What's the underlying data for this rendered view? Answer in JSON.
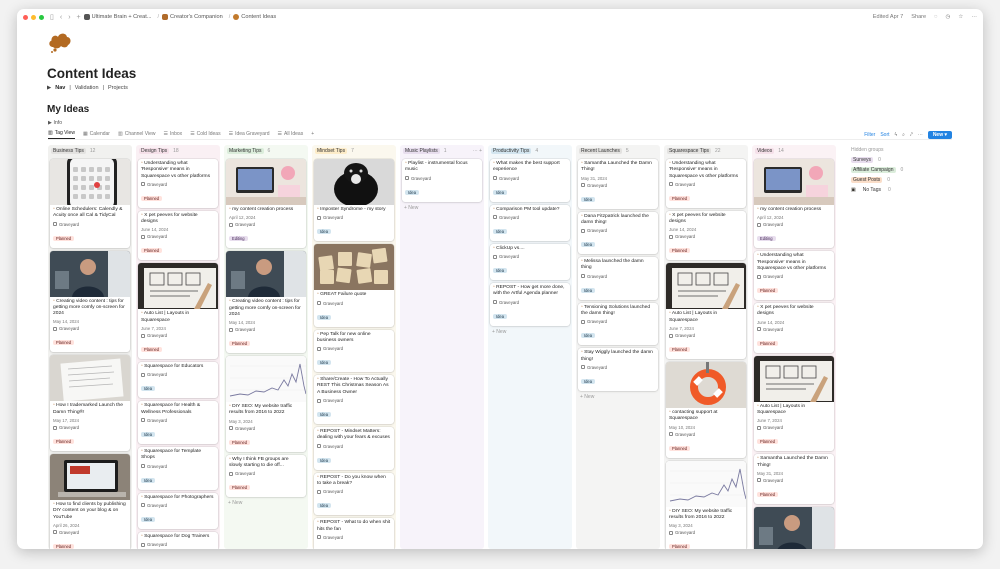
{
  "topbar": {
    "breadcrumbs": [
      "Ultimate Brain + Creat...",
      "Creator's Companion",
      "Content Ideas"
    ],
    "edited": "Edited Apr 7",
    "share": "Share"
  },
  "page": {
    "title": "Content Ideas",
    "nav_label": "Nav",
    "nav_links": [
      "Validation",
      "Projects"
    ],
    "section_title": "My Ideas",
    "info_label": "Info"
  },
  "views": [
    "Tag View",
    "Calendar",
    "Channel View",
    "Inbox",
    "Cold Ideas",
    "Idea Graveyard",
    "All Ideas"
  ],
  "tools": {
    "filter": "Filter",
    "sort": "Sort",
    "new": "New"
  },
  "columns": [
    {
      "name": "Business Tips",
      "count": "12",
      "color": "#f1f1ef",
      "chip": "#e3e2e0",
      "new": "",
      "cards": [
        {
          "cover": "phone",
          "title": "Online Schedulers: Calendly & Acuity once all Cal & TidyCal",
          "date": "",
          "group": "Graveyard",
          "tag": "Planned",
          "tagc": "planned"
        },
        {
          "cover": "man",
          "title": "Creating video content : tips for getting more comfy on-screen for 2024",
          "date": "May 14, 2024",
          "group": "Graveyard",
          "tag": "Planned",
          "tagc": "planned"
        },
        {
          "cover": "paper",
          "title": "How I trademarked Launch the Damn Thing®!",
          "date": "May 17, 2024",
          "group": "Graveyard",
          "tag": "Planned",
          "tagc": "planned"
        },
        {
          "cover": "laptop",
          "title": "How to find clients by publishing DIY content on your blog & on YouTube",
          "date": "April 26, 2024",
          "group": "Graveyard",
          "tag": "Planned",
          "tagc": "planned"
        }
      ]
    },
    {
      "name": "Design Tips",
      "count": "18",
      "color": "#faf0f4",
      "chip": "#f5e0e9",
      "new": "",
      "cards": [
        {
          "cover": "",
          "title": "Understanding what 'Responsive' means in Squarespace vs other platforms",
          "date": "",
          "group": "Graveyard",
          "tag": "Planned",
          "tagc": "planned"
        },
        {
          "cover": "",
          "title": "X pet peeves for website designs",
          "date": "June 14, 2024",
          "group": "Graveyard",
          "tag": "Planned",
          "tagc": "planned"
        },
        {
          "cover": "sketch",
          "title": "Auto List | Layouts in Squarespace",
          "date": "June 7, 2024",
          "group": "Graveyard",
          "tag": "Planned",
          "tagc": "planned"
        },
        {
          "cover": "",
          "title": "Squarespace for Educators",
          "date": "",
          "group": "Graveyard",
          "tag": "Idea",
          "tagc": "idea"
        },
        {
          "cover": "",
          "title": "Squarespace for Health & Wellness Professionals",
          "date": "",
          "group": "Graveyard",
          "tag": "Idea",
          "tagc": "idea"
        },
        {
          "cover": "",
          "title": "Squarespace for Template Shops",
          "date": "",
          "group": "Graveyard",
          "tag": "Idea",
          "tagc": "idea"
        },
        {
          "cover": "",
          "title": "Squarespace for Photographers",
          "date": "",
          "group": "Graveyard",
          "tag": "Idea",
          "tagc": "idea"
        },
        {
          "cover": "",
          "title": "Squarespace for Dog Trainers",
          "date": "",
          "group": "Graveyard",
          "tag": "Idea",
          "tagc": "idea"
        },
        {
          "cover": "",
          "title": "Squarespace for Lawyers",
          "date": "",
          "group": "Graveyard",
          "tag": "",
          "tagc": ""
        }
      ]
    },
    {
      "name": "Marketing Tips",
      "count": "6",
      "color": "#f4f9f2",
      "chip": "#dbeddb",
      "new": "+ New",
      "cards": [
        {
          "cover": "desk",
          "title": "my content creation process",
          "date": "April 12, 2024",
          "group": "Graveyard",
          "tag": "Editing",
          "tagc": "editing"
        },
        {
          "cover": "man",
          "title": "Creating video content : tips for getting more comfy on-screen for 2024",
          "date": "May 14, 2024",
          "group": "Graveyard",
          "tag": "Planned",
          "tagc": "planned"
        },
        {
          "cover": "graph",
          "title": "DIY SEO: My website traffic results from 2016 to 2022",
          "date": "May 3, 2024",
          "group": "Graveyard",
          "tag": "Planned",
          "tagc": "planned"
        },
        {
          "cover": "",
          "title": "Why I think FB groups are slowly starting to die off...",
          "date": "",
          "group": "Graveyard",
          "tag": "Planned",
          "tagc": "planned"
        }
      ]
    },
    {
      "name": "Mindset Tips",
      "count": "7",
      "color": "#fbf8ee",
      "chip": "#fdecc8",
      "new": "+ New",
      "cards": [
        {
          "cover": "dog",
          "title": "Imposter Syndrome - my story",
          "date": "",
          "group": "Graveyard",
          "tag": "Idea",
          "tagc": "idea"
        },
        {
          "cover": "scrabble",
          "title": "GREAT Failure quote",
          "date": "",
          "group": "Graveyard",
          "tag": "Idea",
          "tagc": "idea"
        },
        {
          "cover": "",
          "title": "Pep Talk for new online business owners",
          "date": "",
          "group": "Graveyard",
          "tag": "Idea",
          "tagc": "idea"
        },
        {
          "cover": "",
          "title": "Share/Create - How To Actually REST This Christmas Season As A Business Owner",
          "date": "",
          "group": "Graveyard",
          "tag": "Idea",
          "tagc": "idea"
        },
        {
          "cover": "",
          "title": "REPOST - Mindset Matters: dealing with your fears & excuses",
          "date": "",
          "group": "Graveyard",
          "tag": "Idea",
          "tagc": "idea"
        },
        {
          "cover": "",
          "title": "REPOST - Do you know when to take a break?",
          "date": "",
          "group": "Graveyard",
          "tag": "Idea",
          "tagc": "idea"
        },
        {
          "cover": "",
          "title": "REPOST - What to do when shit hits the fan",
          "date": "",
          "group": "Graveyard",
          "tag": "Idea",
          "tagc": "idea"
        }
      ]
    },
    {
      "name": "Music Playlists",
      "count": "1",
      "color": "#f7f3fa",
      "chip": "#e8deee",
      "new": "+ New",
      "cards": [
        {
          "cover": "",
          "title": "Playlist - instrumental focus music",
          "date": "",
          "group": "Graveyard",
          "tag": "Idea",
          "tagc": "idea"
        }
      ]
    },
    {
      "name": "Productivity Tips",
      "count": "4",
      "color": "#f2f7fa",
      "chip": "#d3e5ef",
      "new": "+ New",
      "cards": [
        {
          "cover": "",
          "title": "What makes the best support experience",
          "date": "",
          "group": "Graveyard",
          "tag": "Idea",
          "tagc": "idea"
        },
        {
          "cover": "",
          "title": "Comparison PM tool update?",
          "date": "",
          "group": "Graveyard",
          "tag": "Idea",
          "tagc": "idea"
        },
        {
          "cover": "",
          "title": "ClickUp vs....",
          "date": "",
          "group": "Graveyard",
          "tag": "Idea",
          "tagc": "idea"
        },
        {
          "cover": "",
          "title": "REPOST - How get more done, with the Artful Agenda planner",
          "date": "",
          "group": "Graveyard",
          "tag": "Idea",
          "tagc": "idea"
        }
      ]
    },
    {
      "name": "Recent Launches",
      "count": "5",
      "color": "#f4f4f3",
      "chip": "#e3e2e0",
      "new": "+ New",
      "cards": [
        {
          "cover": "",
          "title": "Samantha Launched the Damn Thing!",
          "date": "May 31, 2024",
          "group": "Graveyard",
          "tag": "Idea",
          "tagc": "idea"
        },
        {
          "cover": "",
          "title": "Dana Fitzpatrick launched the damn thing!",
          "date": "",
          "group": "Graveyard",
          "tag": "Idea",
          "tagc": "idea"
        },
        {
          "cover": "",
          "title": "Melissa launched the damn thing",
          "date": "",
          "group": "Graveyard",
          "tag": "Idea",
          "tagc": "idea"
        },
        {
          "cover": "",
          "title": "Tensioning Solutions launched the damn thing!",
          "date": "",
          "group": "Graveyard",
          "tag": "Idea",
          "tagc": "idea"
        },
        {
          "cover": "",
          "title": "Stay Wiggly launched the damn thing!",
          "date": "",
          "group": "Graveyard",
          "tag": "Idea",
          "tagc": "idea"
        }
      ]
    },
    {
      "name": "Squarespace Tips",
      "count": "22",
      "color": "#f4f4f3",
      "chip": "#e3e2e0",
      "new": "",
      "cards": [
        {
          "cover": "",
          "title": "Understanding what 'Responsive' means in Squarespace vs other platforms",
          "date": "",
          "group": "Graveyard",
          "tag": "Planned",
          "tagc": "planned"
        },
        {
          "cover": "",
          "title": "X pet peeves for website designs",
          "date": "June 14, 2024",
          "group": "Graveyard",
          "tag": "Planned",
          "tagc": "planned"
        },
        {
          "cover": "sketch",
          "title": "Auto List | Layouts in Squarespace",
          "date": "June 7, 2024",
          "group": "Graveyard",
          "tag": "Planned",
          "tagc": "planned"
        },
        {
          "cover": "buoy",
          "title": "contacting support at Squarespace",
          "date": "May 10, 2024",
          "group": "Graveyard",
          "tag": "Planned",
          "tagc": "planned"
        },
        {
          "cover": "graph",
          "title": "DIY SEO: My website traffic results from 2016 to 2022",
          "date": "May 3, 2024",
          "group": "Graveyard",
          "tag": "Planned",
          "tagc": "planned"
        }
      ]
    },
    {
      "name": "Videos",
      "count": "14",
      "color": "#fbf2f5",
      "chip": "#f5e0e9",
      "new": "",
      "cards": [
        {
          "cover": "desk",
          "title": "my content creation process",
          "date": "April 12, 2024",
          "group": "Graveyard",
          "tag": "Editing",
          "tagc": "editing"
        },
        {
          "cover": "",
          "title": "Understanding what 'Responsive' means in Squarespace vs other platforms",
          "date": "",
          "group": "Graveyard",
          "tag": "Planned",
          "tagc": "planned"
        },
        {
          "cover": "",
          "title": "X pet peeves for website designs",
          "date": "June 14, 2024",
          "group": "Graveyard",
          "tag": "Planned",
          "tagc": "planned"
        },
        {
          "cover": "sketch",
          "title": "Auto List | Layouts in Squarespace",
          "date": "June 7, 2024",
          "group": "Graveyard",
          "tag": "Planned",
          "tagc": "planned"
        },
        {
          "cover": "",
          "title": "Samantha Launched the Damn Thing!",
          "date": "May 31, 2024",
          "group": "Graveyard",
          "tag": "Planned",
          "tagc": "planned"
        },
        {
          "cover": "man",
          "title": "Creating video content : tips for",
          "date": "",
          "group": "",
          "tag": "",
          "tagc": ""
        }
      ]
    }
  ],
  "hidden_groups": {
    "title": "Hidden groups",
    "items": [
      {
        "name": "Surveys",
        "count": "0",
        "bg": "#e8deee"
      },
      {
        "name": "Affiliate Campaign",
        "count": "0",
        "bg": "#dbeddb"
      },
      {
        "name": "Guest Posts",
        "count": "0",
        "bg": "#fadec9"
      },
      {
        "name": "No Tags",
        "count": "0",
        "bg": ""
      }
    ]
  }
}
